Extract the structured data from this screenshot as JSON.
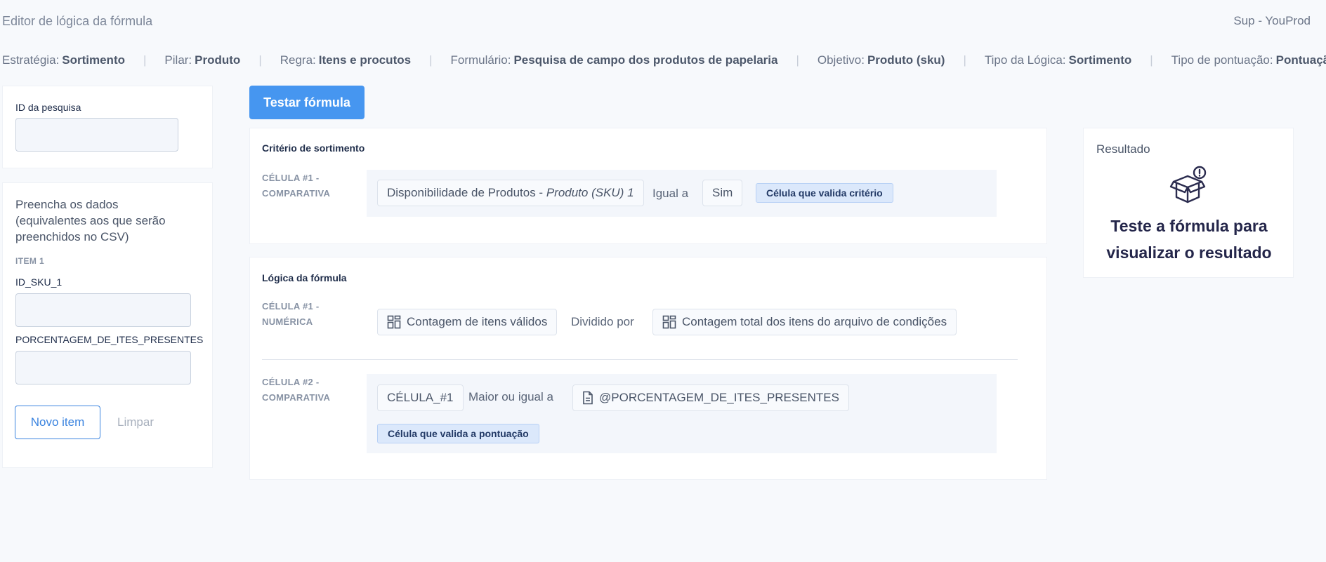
{
  "header": {
    "title": "Editor de lógica da fórmula",
    "user": "Sup - YouProd"
  },
  "meta": [
    {
      "label": "Estratégia:",
      "value": "Sortimento"
    },
    {
      "label": "Pilar:",
      "value": "Produto"
    },
    {
      "label": "Regra:",
      "value": "Itens e procutos"
    },
    {
      "label": "Formulário:",
      "value": "Pesquisa de campo dos produtos de papelaria"
    },
    {
      "label": "Objetivo:",
      "value": "Produto (sku)"
    },
    {
      "label": "Tipo da Lógica:",
      "value": "Sortimento"
    },
    {
      "label": "Tipo de pontuação:",
      "value": "Pontuação dinâmica"
    }
  ],
  "search": {
    "label": "ID da pesquisa",
    "value": ""
  },
  "form": {
    "instructions": "Preencha os dados (equivalentes aos que serão preenchidos no CSV)",
    "item_label": "ITEM 1",
    "field1_label": "ID_SKU_1",
    "field1_value": "",
    "field2_label": "PORCENTAGEM_DE_ITES_PRESENTES",
    "field2_value": "",
    "new_item": "Novo item",
    "clear": "Limpar"
  },
  "test_button": "Testar fórmula",
  "criteria": {
    "title": "Critério de sortimento",
    "cell_label": "CÉLULA #1 - COMPARATIVA",
    "field_main": "Disponibilidade de Produtos - ",
    "field_italic": "Produto (SKU) 1",
    "operator": "Igual a",
    "value": "Sim",
    "badge": "Célula que valida critério"
  },
  "logic": {
    "title": "Lógica da fórmula",
    "cell1": {
      "label": "CÉLULA #1 - NUMÉRICA",
      "left": "Contagem de itens válidos",
      "operator": "Dividido por",
      "right": "Contagem total dos itens do arquivo de condições"
    },
    "cell2": {
      "label": "CÉLULA #2 - COMPARATIVA",
      "left": "CÉLULA_#1",
      "operator": "Maior ou igual a",
      "right": "@PORCENTAGEM_DE_ITES_PRESENTES",
      "badge": "Célula que valida a pontuação"
    }
  },
  "result": {
    "title": "Resultado",
    "message": "Teste a fórmula para visualizar o resultado",
    "icon": "box-alert-icon"
  }
}
